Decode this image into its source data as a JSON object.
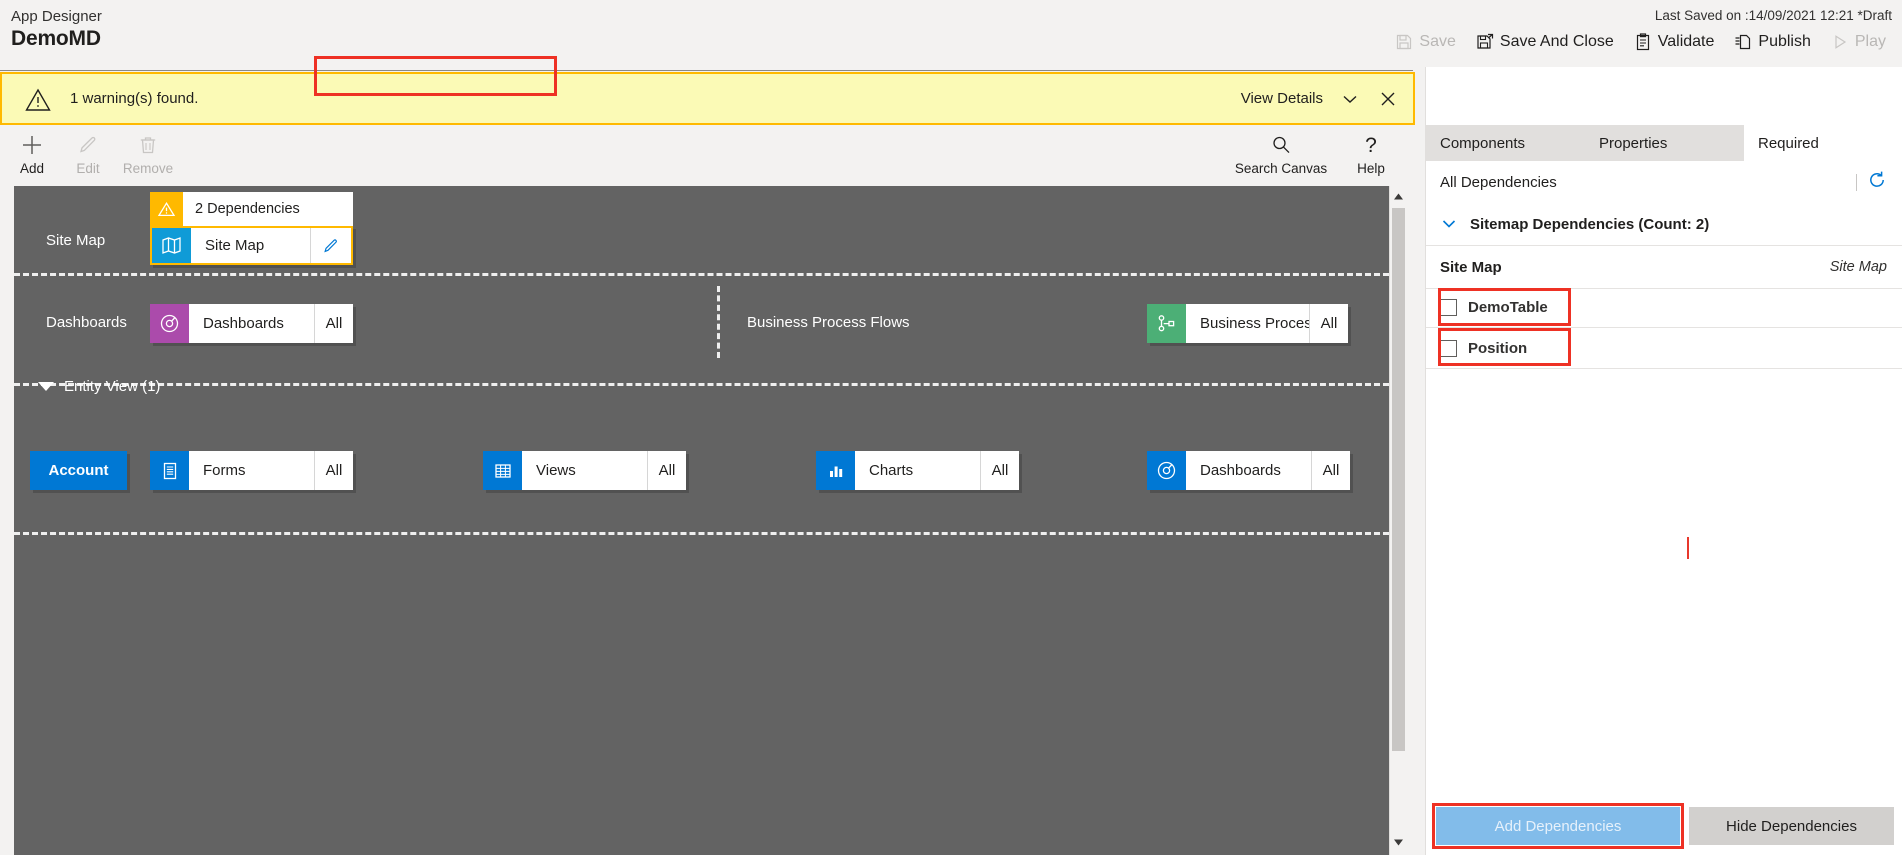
{
  "header": {
    "app_label": "App Designer",
    "app_title": "DemoMD",
    "last_saved": "Last Saved on :14/09/2021 12:21 *Draft",
    "commands": [
      {
        "label": "Save",
        "icon": "save-icon",
        "disabled": true
      },
      {
        "label": "Save And Close",
        "icon": "save-and-close-icon",
        "disabled": false
      },
      {
        "label": "Validate",
        "icon": "validate-icon",
        "disabled": false
      },
      {
        "label": "Publish",
        "icon": "publish-icon",
        "disabled": false
      },
      {
        "label": "Play",
        "icon": "play-icon",
        "disabled": true
      }
    ]
  },
  "warning": {
    "icon": "warning-triangle-icon",
    "text": "1 warning(s) found.",
    "view_details": "View Details",
    "chevron_icon": "chevron-down-icon",
    "close_icon": "close-icon",
    "background": "#fbfab6",
    "border": "#ffb900"
  },
  "toolbar": {
    "add": "Add",
    "edit": "Edit",
    "remove": "Remove",
    "search_canvas": "Search Canvas",
    "help": "Help"
  },
  "canvas": {
    "sitemap_row": {
      "label": "Site Map",
      "dependencies_text": "2 Dependencies",
      "tile_name": "Site Map",
      "tile_icon": "map-icon",
      "edit_icon": "pencil-icon"
    },
    "dashboards_row": {
      "label": "Dashboards",
      "tile_name": "Dashboards",
      "tile_all": "All",
      "tile_icon": "dashboard-icon",
      "tile_color": "#ab4bab"
    },
    "bpf_row": {
      "label": "Business Process Flows",
      "tile_name": "Business Proces...",
      "tile_all": "All",
      "tile_icon": "process-flow-icon",
      "tile_color": "#4caf76"
    },
    "entity_view": {
      "group_label": "Entity View (1)",
      "entity": "Account",
      "tiles": [
        {
          "name": "Forms",
          "all": "All",
          "icon": "forms-icon",
          "color": "#0078d4"
        },
        {
          "name": "Views",
          "all": "All",
          "icon": "views-grid-icon",
          "color": "#0078d4"
        },
        {
          "name": "Charts",
          "all": "All",
          "icon": "charts-bar-icon",
          "color": "#0078d4"
        },
        {
          "name": "Dashboards",
          "all": "All",
          "icon": "dashboard-icon",
          "color": "#0078d4"
        }
      ]
    }
  },
  "right_panel": {
    "tabs": [
      {
        "label": "Components",
        "active": false
      },
      {
        "label": "Properties",
        "active": false
      },
      {
        "label": "Required",
        "active": true,
        "highlighted": true
      }
    ],
    "all_dependencies": "All Dependencies",
    "refresh_icon": "refresh-icon",
    "group": {
      "label": "Sitemap Dependencies (Count: 2)",
      "chevron_icon": "chevron-down-icon"
    },
    "sitemap_header": {
      "name": "Site Map",
      "type": "Site Map"
    },
    "rows": [
      {
        "name": "DemoTable",
        "checked": false,
        "highlighted": true
      },
      {
        "name": "Position",
        "checked": false,
        "highlighted": true
      }
    ],
    "footer": {
      "add_dependencies": "Add Dependencies",
      "add_disabled": true,
      "add_highlighted": true,
      "hide_dependencies": "Hide Dependencies"
    }
  },
  "colors": {
    "accent": "#0078d4",
    "warning": "#ffb900",
    "highlight": "#ee3124",
    "canvas_bg": "#636363"
  }
}
